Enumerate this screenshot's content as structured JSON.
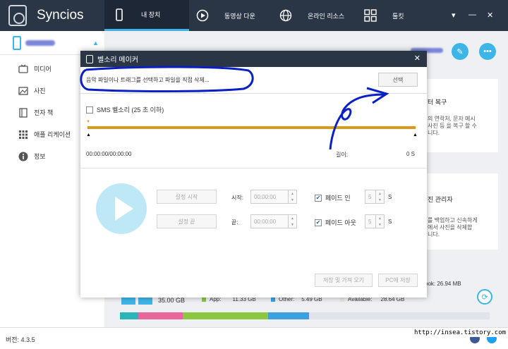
{
  "app": {
    "name": "Syncios",
    "version": "버전: 4.3.5"
  },
  "nav": {
    "tabs": [
      {
        "label": "내 장치",
        "icon": "phone-icon",
        "active": true
      },
      {
        "label": "동영상 다운",
        "icon": "play-icon"
      },
      {
        "label": "온라인 리소스",
        "icon": "globe-icon"
      },
      {
        "label": "툴킷",
        "icon": "toolkit-icon"
      }
    ]
  },
  "sidebar": {
    "items": [
      {
        "label": "미디어",
        "icon": "media-icon"
      },
      {
        "label": "사진",
        "icon": "photo-icon"
      },
      {
        "label": "전자 책",
        "icon": "ebook-icon"
      },
      {
        "label": "애플 리케이션",
        "icon": "apps-icon"
      },
      {
        "label": "정보",
        "icon": "info-icon"
      }
    ]
  },
  "cards": {
    "backup": {
      "title": "터 복구",
      "text": [
        "의 연락처, 문자 메시",
        "사진 등 을 복구 할 수",
        "니다."
      ]
    },
    "photo": {
      "title": "진 관리자",
      "text": [
        "를 백업하고 신속하게",
        "에서 사진을 삭제합",
        "니다."
      ]
    }
  },
  "storage": {
    "total": "35.00 GB",
    "app_label": "App:",
    "app_value": "11.33 GB",
    "other_label": "Other:",
    "other_value": "5.49 GB",
    "available_label": "Available:",
    "available_value": "28.64 GB",
    "book_label": "ook:",
    "book_value": "26.94 MB",
    "colors": {
      "teal": "#2bb5b8",
      "pink": "#e8679a",
      "green": "#8dc63f",
      "blue": "#3aa0e0",
      "yellow": "#f2c12e"
    },
    "segments": [
      {
        "color": "#2bb5b8",
        "fraction": 0.05
      },
      {
        "color": "#e8679a",
        "fraction": 0.12
      },
      {
        "color": "#8dc63f",
        "fraction": 0.23
      },
      {
        "color": "#3aa0e0",
        "fraction": 0.11
      }
    ]
  },
  "dialog": {
    "title": "벨소리 메이커",
    "file_hint": "음악 파일이나 트래그를 선택하고 파일을 직접 삭제...",
    "select_label": "선택",
    "sms_label": "SMS 벨소리 (25 초 이하)",
    "time": "00:00:00/00:00:00",
    "length_label": "길이:",
    "length_value": "0 S",
    "set_start": "설정 시작",
    "set_end": "설정 끝",
    "start_label": "시작:",
    "end_label": "끝:",
    "start_value": "00:00:00",
    "end_value": "00:00:00",
    "fade_in_label": "페이드 인",
    "fade_out_label": "페이드 아웃",
    "fade_in_value": "5",
    "fade_out_value": "5",
    "unit_s": "S",
    "save_label": "저장 및 가져 오기",
    "save_pc_label": "PC에 저장"
  },
  "watermark": "http://insea.tistory.com"
}
